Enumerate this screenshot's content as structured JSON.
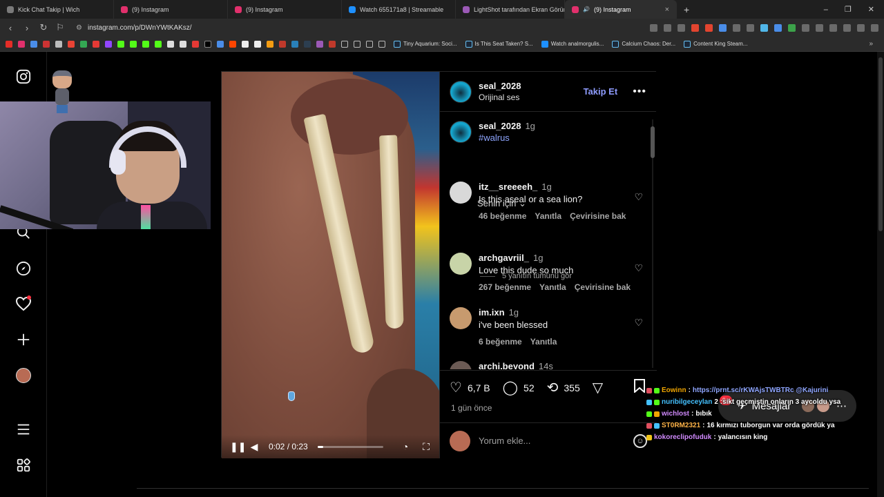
{
  "browser": {
    "tabs": [
      {
        "title": "Kick Chat Takip | Wich",
        "color": "#7a7a7a"
      },
      {
        "title": "(9) Instagram",
        "color": "#e1306c"
      },
      {
        "title": "(9) Instagram",
        "color": "#e1306c"
      },
      {
        "title": "Watch 655171a8 | Streamable",
        "color": "#1e90ff"
      },
      {
        "title": "LightShot tarafından Ekran Görüntüsü",
        "color": "#9b59b6"
      },
      {
        "title": "(9) Instagram",
        "color": "#e1306c",
        "active": true
      }
    ],
    "new_tab": "+",
    "url": "instagram.com/p/DWnYWtKAKsz/",
    "bookmarks_named": [
      "Tiny Aquarium: Soci...",
      "Is This Seat Taken? S...",
      "Watch analmorgulis...",
      "Calcium Chaos: Der...",
      "Content King Steam..."
    ]
  },
  "sidebar": {
    "icons": [
      "instagram-logo",
      "search-icon",
      "explore-icon",
      "heart-icon",
      "create-icon",
      "profile-avatar",
      "menu-icon",
      "apps-icon"
    ]
  },
  "post": {
    "author": "seal_2028",
    "audio": "Orijinal ses",
    "follow_label": "Takip Et",
    "caption": {
      "user": "seal_2028",
      "time": "1g",
      "hashtag": "#walrus"
    },
    "sort_label": "Senin için",
    "comments": [
      {
        "user": "itz__sreeeeh_",
        "time": "1g",
        "text": "Is this aseal or a sea lion?",
        "likes": "46 beğenme",
        "reply": "Yanıtla",
        "translate": "Çevirisine bak",
        "avatar_color": "#d9d9d9"
      },
      {
        "user": "archgavriil_",
        "time": "1g",
        "text": "Love this dude so much",
        "likes": "267 beğenme",
        "reply": "Yanıtla",
        "translate": "Çevirisine bak",
        "avatar_color": "#c8d4a8"
      },
      {
        "user": "im.ixn",
        "time": "1g",
        "text": "i've been blessed",
        "likes": "6 beğenme",
        "reply": "Yanıtla",
        "avatar_color": "#c79a6e"
      },
      {
        "user": "archi.beyond",
        "time": "14s",
        "avatar_color": "#6b5a54"
      }
    ],
    "view_replies": "5 yanıtın tümünü gör",
    "stats": {
      "likes": "6,7 B",
      "comments": "52",
      "reposts": "355"
    },
    "posted_ago": "1 gün önce",
    "add_comment_placeholder": "Yorum ekle...",
    "video": {
      "time": "0:02 / 0:23",
      "progress": 0.087
    }
  },
  "messages": {
    "label": "Mesajlar",
    "unread": "9+"
  },
  "chat": [
    {
      "user": "Eowinn",
      "msg": "https://prnt.sc/rKWAjsTWBTRc @Kajurini",
      "color": "#f0a500"
    },
    {
      "user": "nuribilgeceylan",
      "msg": "2 :sikt geçmiştin onların 3 aycoldu ysa",
      "color": "#44c1ff"
    },
    {
      "user": "wichlost",
      "msg": "bıbık",
      "color": "#d28bff"
    },
    {
      "user": "ST0RM2321",
      "msg": "16 kırmızı tuborgun var orda gördük ya",
      "color": "#ffb347"
    },
    {
      "user": "kokoreclipofuduk",
      "msg": "yalancısın king",
      "color": "#d28bff"
    }
  ]
}
